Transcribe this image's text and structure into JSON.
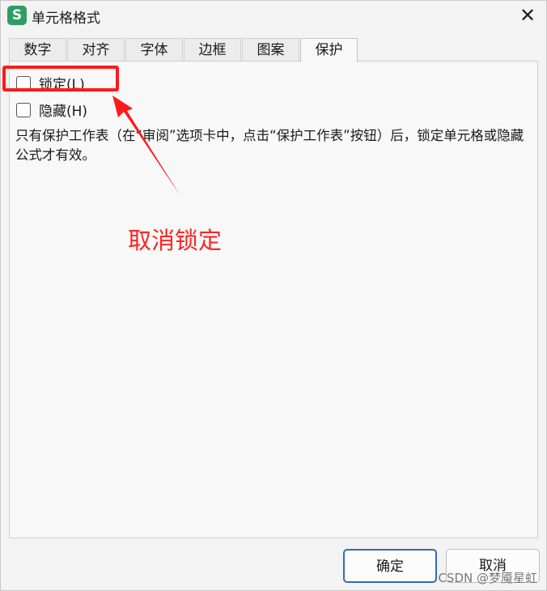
{
  "window": {
    "title": "单元格格式",
    "app_icon_letter": "S",
    "close_symbol": "✕"
  },
  "tabs": [
    {
      "label": "数字",
      "active": false
    },
    {
      "label": "对齐",
      "active": false
    },
    {
      "label": "字体",
      "active": false
    },
    {
      "label": "边框",
      "active": false
    },
    {
      "label": "图案",
      "active": false
    },
    {
      "label": "保护",
      "active": true
    }
  ],
  "protection": {
    "locked": {
      "label": "锁定(L)",
      "checked": false
    },
    "hidden": {
      "label": "隐藏(H)",
      "checked": false
    },
    "description": "只有保护工作表（在“审阅”选项卡中，点击“保护工作表”按钮）后，锁定单元格或隐藏公式才有效。"
  },
  "annotation": {
    "text": "取消锁定",
    "color": "#ff2424"
  },
  "buttons": {
    "ok": "确定",
    "cancel": "取消"
  },
  "watermark": "CSDN @梦魇星虹",
  "colors": {
    "accent": "#2d6db6",
    "app_icon": "#2e9e63",
    "annotation": "#ff1a1a"
  }
}
